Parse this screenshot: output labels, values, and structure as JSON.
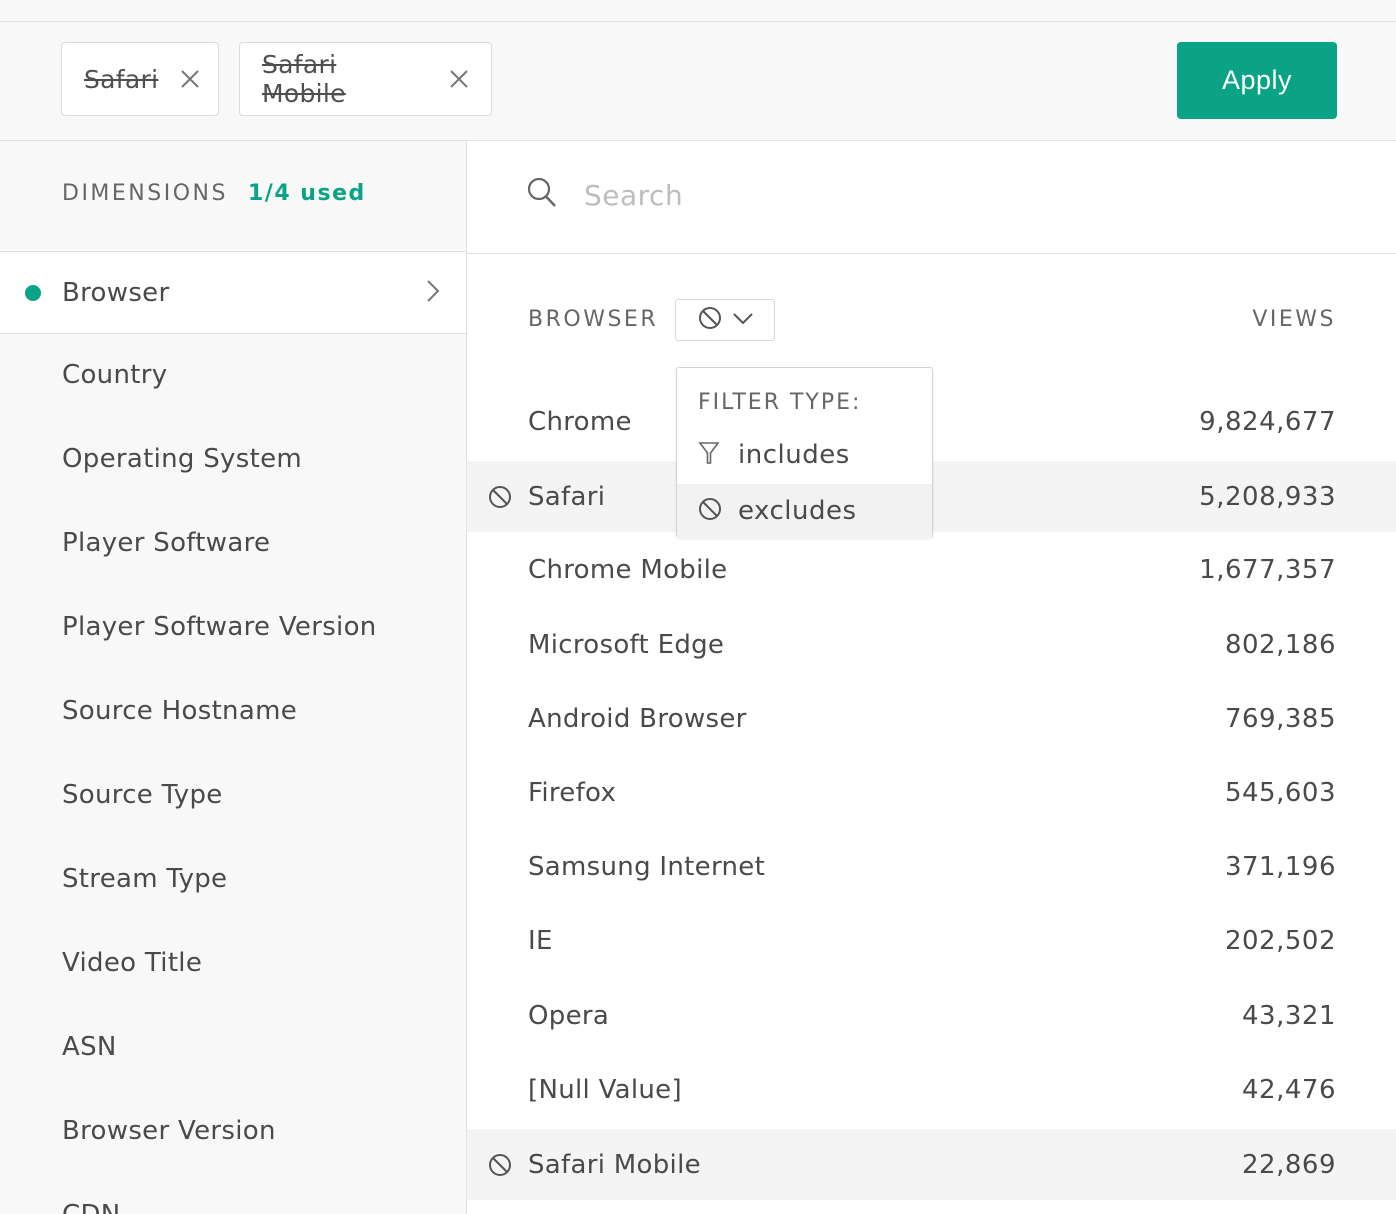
{
  "filters": {
    "chips": [
      {
        "label": "Safari"
      },
      {
        "label": "Safari Mobile"
      }
    ],
    "apply_label": "Apply"
  },
  "sidebar": {
    "heading": "DIMENSIONS",
    "used": "1/4 used",
    "items": [
      {
        "label": "Browser",
        "active": true
      },
      {
        "label": "Country"
      },
      {
        "label": "Operating System"
      },
      {
        "label": "Player Software"
      },
      {
        "label": "Player Software Version"
      },
      {
        "label": "Source Hostname"
      },
      {
        "label": "Source Type"
      },
      {
        "label": "Stream Type"
      },
      {
        "label": "Video Title"
      },
      {
        "label": "ASN"
      },
      {
        "label": "Browser Version"
      },
      {
        "label": "CDN"
      }
    ]
  },
  "search": {
    "placeholder": "Search"
  },
  "table": {
    "col_browser": "BROWSER",
    "col_views": "VIEWS",
    "filter_type_icon": "excludes-icon",
    "rows": [
      {
        "name": "Chrome",
        "views": "9,824,677"
      },
      {
        "name": "Safari",
        "views": "5,208,933",
        "excluded": true
      },
      {
        "name": "Chrome Mobile",
        "views": "1,677,357"
      },
      {
        "name": "Microsoft Edge",
        "views": "802,186"
      },
      {
        "name": "Android Browser",
        "views": "769,385"
      },
      {
        "name": "Firefox",
        "views": "545,603"
      },
      {
        "name": "Samsung Internet",
        "views": "371,196"
      },
      {
        "name": "IE",
        "views": "202,502"
      },
      {
        "name": "Opera",
        "views": "43,321"
      },
      {
        "name": "[Null Value]",
        "views": "42,476"
      },
      {
        "name": "Safari Mobile",
        "views": "22,869",
        "excluded": true
      }
    ]
  },
  "dropdown": {
    "title": "FILTER TYPE:",
    "options": [
      {
        "label": "includes",
        "icon": "filter-icon"
      },
      {
        "label": "excludes",
        "icon": "excludes-icon",
        "highlighted": true
      }
    ]
  },
  "colors": {
    "accent": "#0aa386"
  }
}
